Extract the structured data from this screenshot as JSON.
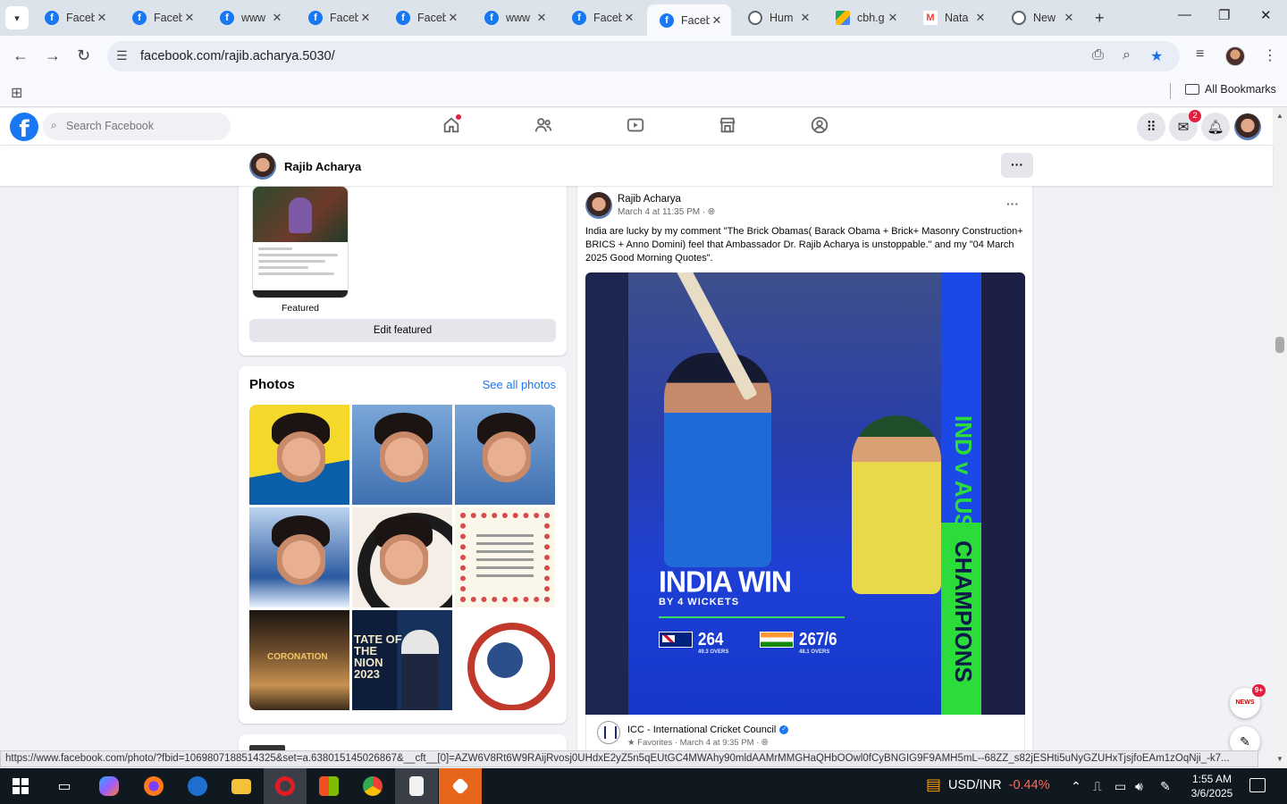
{
  "browser": {
    "tabs": [
      {
        "title": "Faceb",
        "icon": "facebook-icon",
        "active": false
      },
      {
        "title": "Faceb",
        "icon": "facebook-icon",
        "active": false
      },
      {
        "title": "www",
        "icon": "facebook-icon",
        "active": false
      },
      {
        "title": "Faceb",
        "icon": "facebook-icon",
        "active": false
      },
      {
        "title": "Faceb",
        "icon": "facebook-icon",
        "active": false
      },
      {
        "title": "www",
        "icon": "facebook-icon",
        "active": false
      },
      {
        "title": "Faceb",
        "icon": "facebook-icon",
        "active": false
      },
      {
        "title": "Faceb",
        "icon": "facebook-icon",
        "active": true
      },
      {
        "title": "Hum",
        "icon": "globe-icon",
        "active": false
      },
      {
        "title": "cbh.g",
        "icon": "google-drive-icon",
        "active": false
      },
      {
        "title": "Nata",
        "icon": "gmail-icon",
        "active": false
      },
      {
        "title": "New",
        "icon": "globe-icon",
        "active": false
      }
    ],
    "url": "facebook.com/rajib.acharya.5030/",
    "bookmarks_label": "All Bookmarks",
    "status_url": "https://www.facebook.com/photo/?fbid=1069807188514325&set=a.638015145026867&__cft__[0]=AZW6V8Rt6W9RAijRvosj0UHdxE2yZ5n5qEUtGC4MWAhy90mldAAMrMMGHaQHbOOwl0fCyBNGIG9F9AMH5mL--68ZZ_s82jESHti5uNyGZUHxTjsjfoEAm1zOqNji_-k7..."
  },
  "facebook": {
    "search_placeholder": "Search Facebook",
    "messenger_badge": "2",
    "profile_name": "Rajib Acharya",
    "featured": {
      "label": "Featured",
      "edit_button": "Edit featured"
    },
    "photos": {
      "title": "Photos",
      "see_all": "See all photos",
      "tiles": [
        {
          "name": "stay-alert-frame-photo"
        },
        {
          "name": "profile-portrait-photo"
        },
        {
          "name": "profile-portrait-photo"
        },
        {
          "name": "sparkle-portrait-photo"
        },
        {
          "name": "covid-vaccine-frame-photo"
        },
        {
          "name": "certificate-photo"
        },
        {
          "name": "coronation-photo",
          "text": "CORONATION"
        },
        {
          "name": "state-of-union-photo",
          "text": "TATE OF THE NION 2023"
        },
        {
          "name": "king-charles-coronation-emblem-photo"
        }
      ]
    },
    "post": {
      "author": "Rajib Acharya",
      "time": "March 4 at 11:35 PM",
      "text": "India are lucky by my comment \"The Brick Obamas( Barack Obama + Brick+ Masonry Construction+ BRICS + Anno Domini) feel that Ambassador Dr. Rajib Acharya is unstoppable.\" and my \"04 March 2025 Good Morning Quotes\".",
      "image": {
        "headline": "INDIA WIN",
        "subline": "BY 4 WICKETS",
        "aus_score": "264",
        "aus_overs": "49.3 OVERS",
        "ind_score": "267/6",
        "ind_overs": "48.1 OVERS",
        "side_top": "IND v AUS",
        "side_bottom": "CHAMPIONS"
      },
      "shared_from": "ICC - International Cricket Council",
      "shared_meta": "Favorites · March 4 at 9:35 PM ·"
    },
    "news_badge": "9+"
  },
  "taskbar": {
    "ticker_symbol": "USD/INR",
    "ticker_change": "-0.44%",
    "time": "1:55 AM",
    "date": "3/6/2025"
  },
  "colors": {
    "facebook_blue": "#1877f2",
    "badge_red": "#e41e3f",
    "ticker_negative": "#ff6b5b"
  }
}
